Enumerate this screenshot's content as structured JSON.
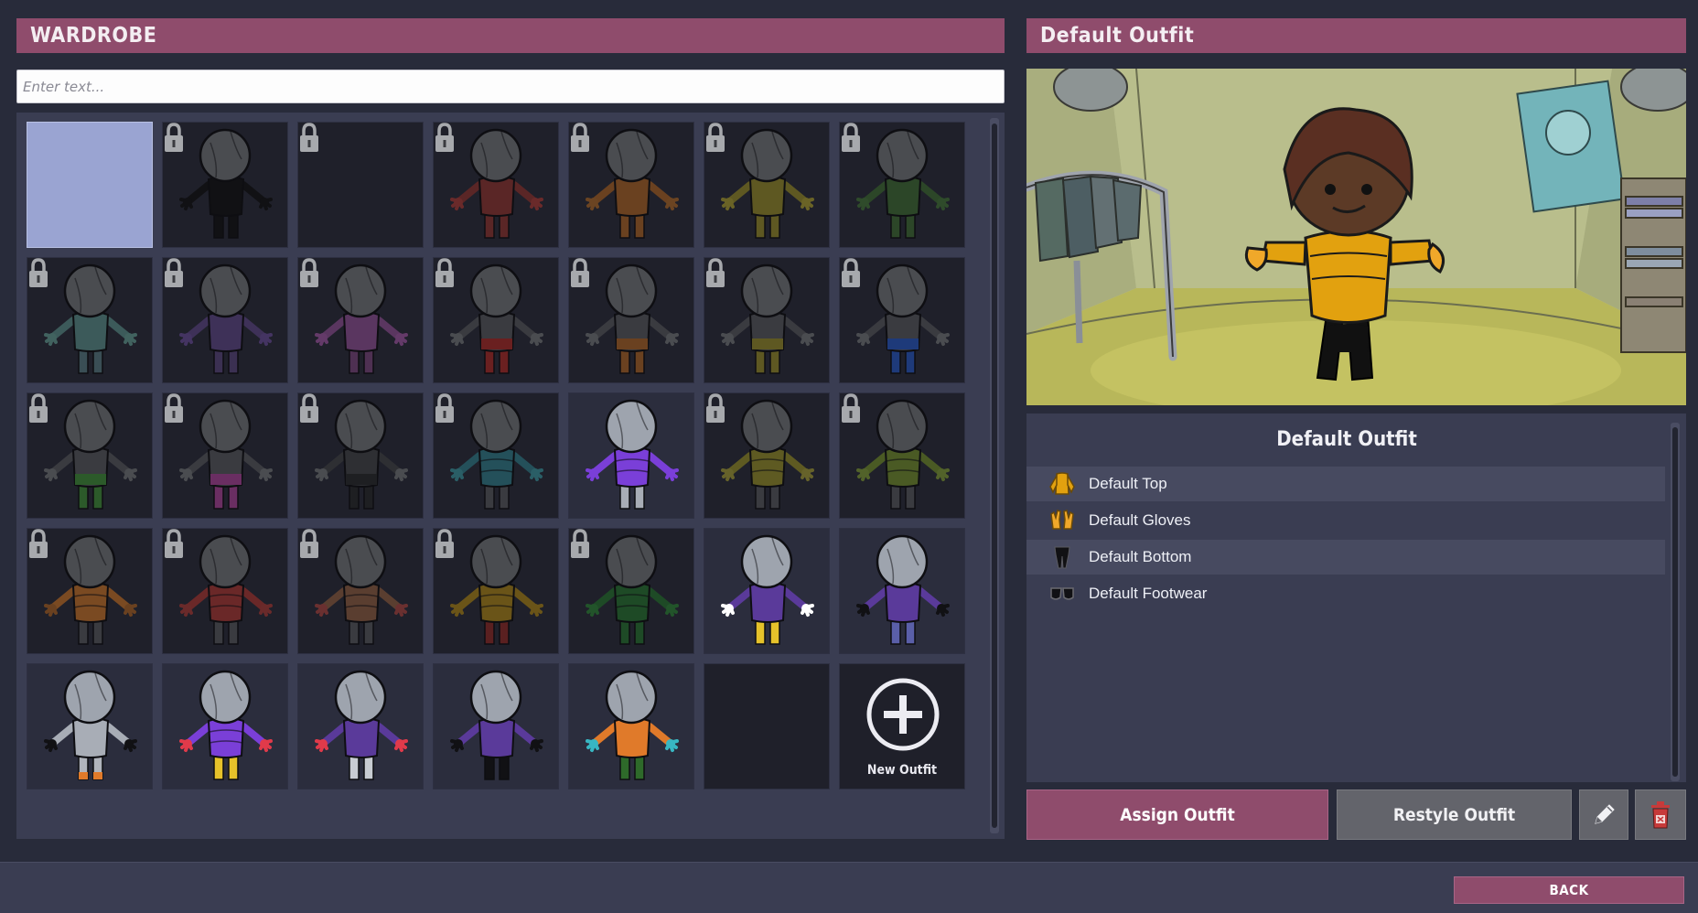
{
  "wardrobe": {
    "title": "WARDROBE",
    "search_placeholder": "Enter text...",
    "new_outfit_label": "New Outfit",
    "tiles": [
      {
        "kind": "selected"
      },
      {
        "kind": "locked",
        "top": "#111114",
        "hands": "#111114",
        "legs": "#111114",
        "head": "#4a4c50"
      },
      {
        "kind": "locked-empty"
      },
      {
        "kind": "locked",
        "top": "#5a2626",
        "hands": "#6a2a2a",
        "legs": "#5a2626",
        "head": "#4a4c50"
      },
      {
        "kind": "locked",
        "top": "#6a4120",
        "hands": "#6b4422",
        "legs": "#6a4120",
        "head": "#4a4c50"
      },
      {
        "kind": "locked",
        "top": "#5e5822",
        "hands": "#6a6326",
        "legs": "#5e5822",
        "head": "#4a4c50"
      },
      {
        "kind": "locked",
        "top": "#2c4628",
        "hands": "#2f4b2b",
        "legs": "#2c4628",
        "head": "#4a4c50"
      },
      {
        "kind": "locked",
        "top": "#3c5a5a",
        "hands": "#41625f",
        "legs": "#3a4e55",
        "head": "#4a4c50"
      },
      {
        "kind": "locked",
        "top": "#3e3158",
        "hands": "#443462",
        "legs": "#3b3052",
        "head": "#4a4c50"
      },
      {
        "kind": "locked",
        "top": "#5a3660",
        "hands": "#643a69",
        "legs": "#4e3052",
        "head": "#4a4c50"
      },
      {
        "kind": "locked",
        "top": "#3a3b40",
        "hands": "#4a4c50",
        "legs": "#6a2020",
        "head": "#4a4c50",
        "band": "#6a2020"
      },
      {
        "kind": "locked",
        "top": "#3a3b40",
        "hands": "#4a4c50",
        "legs": "#6a4120",
        "head": "#4a4c50",
        "band": "#6a4120"
      },
      {
        "kind": "locked",
        "top": "#3a3b40",
        "hands": "#4a4c50",
        "legs": "#5e5822",
        "head": "#4a4c50",
        "band": "#5e5822"
      },
      {
        "kind": "locked",
        "top": "#3a3b40",
        "hands": "#4a4c50",
        "legs": "#1e3a7a",
        "head": "#4a4c50",
        "band": "#1e3a7a"
      },
      {
        "kind": "locked",
        "top": "#3a3b40",
        "hands": "#4a4c50",
        "legs": "#2c5a2a",
        "head": "#4a4c50",
        "band": "#2c5a2a"
      },
      {
        "kind": "locked",
        "top": "#3a3b40",
        "hands": "#4a4c50",
        "legs": "#6a2e62",
        "head": "#4a4c50",
        "band": "#6a2e62"
      },
      {
        "kind": "locked",
        "top": "#2e2f33",
        "hands": "#4a4c50",
        "legs": "#1e1f22",
        "head": "#4a4c50",
        "band": "#1e1f22"
      },
      {
        "kind": "locked",
        "top": "#24505a",
        "hands": "#2a5e66",
        "legs": "#3a3b40",
        "head": "#4a4c50",
        "puffer": true
      },
      {
        "kind": "unlocked",
        "top": "#7a3fd8",
        "hands": "#7a3fd8",
        "legs": "#a8adb6",
        "head": "#9ea4ae",
        "puffer": true
      },
      {
        "kind": "locked",
        "top": "#5e5a22",
        "hands": "#66622a",
        "legs": "#3a3b40",
        "head": "#4a4c50",
        "puffer": true
      },
      {
        "kind": "locked",
        "top": "#4a5a24",
        "hands": "#52622a",
        "legs": "#3a3b40",
        "head": "#4a4c50",
        "puffer": true
      },
      {
        "kind": "locked",
        "top": "#7a4a22",
        "hands": "#6a4120",
        "legs": "#3a3b40",
        "head": "#4a4c50",
        "puffer": true
      },
      {
        "kind": "locked",
        "top": "#6a2828",
        "hands": "#6a2a2a",
        "legs": "#3a3b40",
        "head": "#4a4c50",
        "puffer": true
      },
      {
        "kind": "locked",
        "top": "#5a3e30",
        "hands": "#6a3030",
        "legs": "#3a3b40",
        "head": "#4a4c50",
        "puffer": true
      },
      {
        "kind": "locked",
        "top": "#6a5418",
        "hands": "#6a5418",
        "legs": "#5a2020",
        "head": "#4a4c50",
        "puffer": true
      },
      {
        "kind": "locked",
        "top": "#1e4a26",
        "hands": "#22542a",
        "legs": "#1e4a26",
        "head": "#4a4c50",
        "puffer": true
      },
      {
        "kind": "unlocked",
        "top": "#5a3a9a",
        "hands": "#ffffff",
        "legs": "#e6c22a",
        "head": "#9ea4ae"
      },
      {
        "kind": "unlocked",
        "top": "#5a3a9a",
        "hands": "#111114",
        "legs": "#5a5fa8",
        "head": "#9ea4ae"
      },
      {
        "kind": "unlocked",
        "top": "#a8adb6",
        "hands": "#111114",
        "legs": "#b0b4bc",
        "head": "#9ea4ae",
        "shoes": "#e07a2a"
      },
      {
        "kind": "unlocked",
        "top": "#7a3fd8",
        "hands": "#e03a4a",
        "legs": "#e6c22a",
        "head": "#9ea4ae",
        "puffer": true
      },
      {
        "kind": "unlocked",
        "top": "#5a3a9a",
        "hands": "#e03a4a",
        "legs": "#c8ccd2",
        "head": "#9ea4ae"
      },
      {
        "kind": "unlocked",
        "top": "#5a3a9a",
        "hands": "#111114",
        "legs": "#111114",
        "head": "#9ea4ae"
      },
      {
        "kind": "unlocked",
        "top": "#e07a2a",
        "hands": "#38b6c2",
        "legs": "#2e6a2a",
        "head": "#9ea4ae"
      },
      {
        "kind": "empty"
      },
      {
        "kind": "new"
      }
    ]
  },
  "outfit": {
    "header_title": "Default Outfit",
    "details_title": "Default Outfit",
    "items": [
      {
        "label": "Default Top",
        "icon": "top-icon"
      },
      {
        "label": "Default Gloves",
        "icon": "gloves-icon"
      },
      {
        "label": "Default Bottom",
        "icon": "bottom-icon"
      },
      {
        "label": "Default Footwear",
        "icon": "footwear-icon"
      }
    ]
  },
  "actions": {
    "assign_label": "Assign Outfit",
    "restyle_label": "Restyle Outfit",
    "edit_icon": "pencil-icon",
    "delete_icon": "trash-icon"
  },
  "footer": {
    "back_label": "BACK"
  },
  "colors": {
    "accent": "#8f4c6c",
    "panel": "#3a3d52",
    "background": "#282b3a",
    "selected_tile": "#9aa4d2"
  }
}
